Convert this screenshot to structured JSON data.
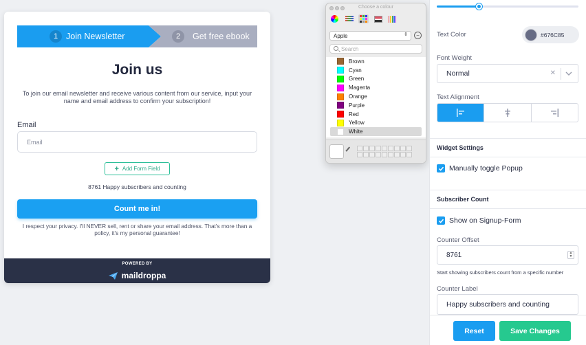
{
  "signup_form": {
    "steps": [
      {
        "number": "1",
        "label": "Join Newsletter"
      },
      {
        "number": "2",
        "label": "Get free ebook"
      }
    ],
    "title": "Join us",
    "description": "To join our email newsletter and receive various content from our service, input your name and email address to confirm your subscription!",
    "email_label": "Email",
    "email_placeholder": "Email",
    "add_field_label": "Add Form Field",
    "subscriber_count_text": "8761 Happy subscribers and counting",
    "submit_label": "Count me in!",
    "privacy_text": "I respect your privacy. I'll NEVER sell, rent or share your email address. That's more than a policy, it's my personal guarantee!",
    "powered_by": "POWERED BY",
    "brand": "maildroppa"
  },
  "colour_picker": {
    "title": "Choose a colour",
    "palette": "Apple",
    "search_placeholder": "Search",
    "colors": [
      {
        "name": "Brown",
        "hex": "#996633"
      },
      {
        "name": "Cyan",
        "hex": "#00ffff"
      },
      {
        "name": "Green",
        "hex": "#00ff00"
      },
      {
        "name": "Magenta",
        "hex": "#ff00ff"
      },
      {
        "name": "Orange",
        "hex": "#ff8000"
      },
      {
        "name": "Purple",
        "hex": "#800080"
      },
      {
        "name": "Red",
        "hex": "#ff0000"
      },
      {
        "name": "Yellow",
        "hex": "#ffff00"
      },
      {
        "name": "White",
        "hex": "#ffffff"
      }
    ],
    "selected": "White"
  },
  "settings": {
    "slider_value_fraction": 0.3,
    "text_color_label": "Text Color",
    "text_color_value": "#676C85",
    "font_weight_label": "Font Weight",
    "font_weight_value": "Normal",
    "text_alignment_label": "Text Alignment",
    "text_alignment_selected": "left",
    "widget_settings_heading": "Widget Settings",
    "manually_toggle_label": "Manually toggle Popup",
    "subscriber_count_heading": "Subscriber Count",
    "show_on_form_label": "Show on Signup-Form",
    "counter_offset_label": "Counter Offset",
    "counter_offset_value": "8761",
    "counter_offset_hint": "Start showing subscribers count from a specific number",
    "counter_label_label": "Counter Label",
    "counter_label_value": "Happy subscribers and counting",
    "reset_label": "Reset",
    "save_label": "Save Changes"
  },
  "colors": {
    "primary": "#1a9df0",
    "save": "#26c98f",
    "footer": "#2a3147",
    "step_inactive": "#a9aec0"
  }
}
